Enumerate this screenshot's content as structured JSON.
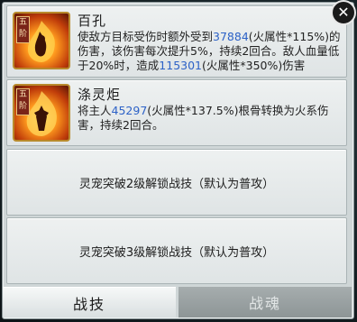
{
  "close_label": "✕",
  "skills": [
    {
      "rank": "五阶",
      "name": "百孔",
      "desc_parts": [
        {
          "t": "使敌方目标受伤时额外受到",
          "c": "text"
        },
        {
          "t": "37884",
          "c": "num"
        },
        {
          "t": "(火属性*115%)的伤害，该伤害每次提升5%，持续2回合。敌人血量低于20%时，造成",
          "c": "text"
        },
        {
          "t": "115301",
          "c": "num"
        },
        {
          "t": "(火属性*350%)伤害",
          "c": "text"
        }
      ]
    },
    {
      "rank": "五阶",
      "name": "涤灵炬",
      "desc_parts": [
        {
          "t": "将主人",
          "c": "text"
        },
        {
          "t": "45297",
          "c": "num"
        },
        {
          "t": "(火属性*137.5%)根骨转换为火系伤害，持续2回合。",
          "c": "text"
        }
      ]
    }
  ],
  "locked_slots": [
    "灵宠突破2级解锁战技（默认为普攻）",
    "灵宠突破3级解锁战技（默认为普攻）"
  ],
  "tabs": {
    "active": "战技",
    "inactive": "战魂"
  },
  "colors": {
    "number_accent": "#2d62c7",
    "icon_border": "#b98a2c"
  }
}
